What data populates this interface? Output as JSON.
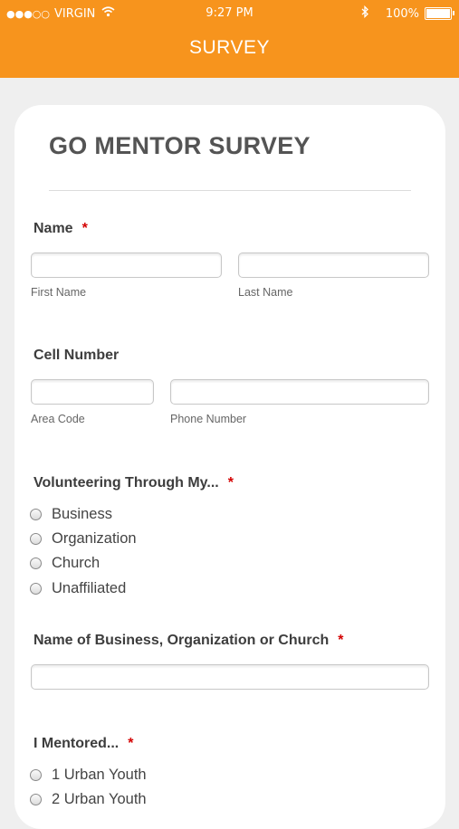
{
  "status_bar": {
    "signal_dots": "●●●○○",
    "carrier": "VIRGIN",
    "time": "9:27 PM",
    "battery": "100%"
  },
  "nav": {
    "title": "SURVEY"
  },
  "form": {
    "title": "GO MENTOR SURVEY",
    "required_marker": "*",
    "name": {
      "label": "Name",
      "first_name_label": "First Name",
      "last_name_label": "Last Name"
    },
    "cell": {
      "label": "Cell Number",
      "area_code_label": "Area Code",
      "phone_number_label": "Phone Number"
    },
    "volunteering": {
      "label": "Volunteering Through My...",
      "options": [
        "Business",
        "Organization",
        "Church",
        "Unaffiliated"
      ]
    },
    "org_name": {
      "label": "Name of Business, Organization or Church"
    },
    "mentored": {
      "label": "I Mentored...",
      "options": [
        "1 Urban Youth",
        "2 Urban Youth"
      ]
    }
  }
}
